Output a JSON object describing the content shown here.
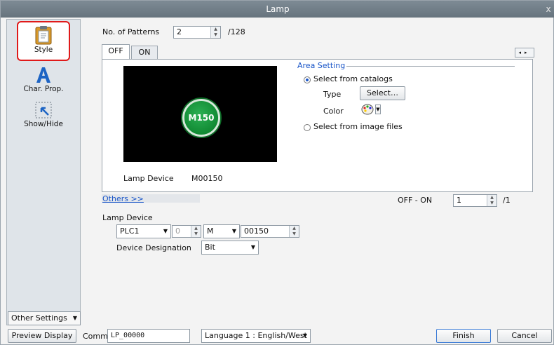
{
  "window": {
    "title": "Lamp",
    "close_glyph": "x"
  },
  "sidebar": {
    "items": [
      {
        "label": "Style",
        "icon": "clipboard-icon",
        "selected": true
      },
      {
        "label": "Char. Prop.",
        "icon": "letter-a-icon",
        "selected": false
      },
      {
        "label": "Show/Hide",
        "icon": "cursor-select-icon",
        "selected": false
      }
    ],
    "other_settings": "Other Settings"
  },
  "patterns": {
    "label": "No. of Patterns",
    "value": "2",
    "max": "/128"
  },
  "tabs": [
    {
      "label": "OFF",
      "active": true
    },
    {
      "label": "ON",
      "active": false
    }
  ],
  "preview": {
    "lamp_text": "M150",
    "device_label": "Lamp Device",
    "device_value": "M00150"
  },
  "area_setting": {
    "title": "Area Setting",
    "opt_catalog": "Select from catalogs",
    "type_label": "Type",
    "select_button": "Select…",
    "color_label": "Color",
    "opt_image": "Select from image files"
  },
  "others_link": "Others >>",
  "off_on": {
    "label": "OFF - ON",
    "value": "1",
    "max": "/1"
  },
  "lamp_device": {
    "label": "Lamp Device",
    "plc": "PLC1",
    "station": "0",
    "device_type": "M",
    "address": "00150",
    "designation_label": "Device Designation",
    "designation_value": "Bit"
  },
  "footer": {
    "preview_button": "Preview Display",
    "comm_label": "Comm",
    "comm_value": "LP_00000",
    "language": "Language 1 : English/West",
    "finish": "Finish",
    "cancel": "Cancel"
  },
  "colors": {
    "selection_outline": "#e01a1a",
    "link": "#1a56c8",
    "lamp_green": "#118a33"
  }
}
